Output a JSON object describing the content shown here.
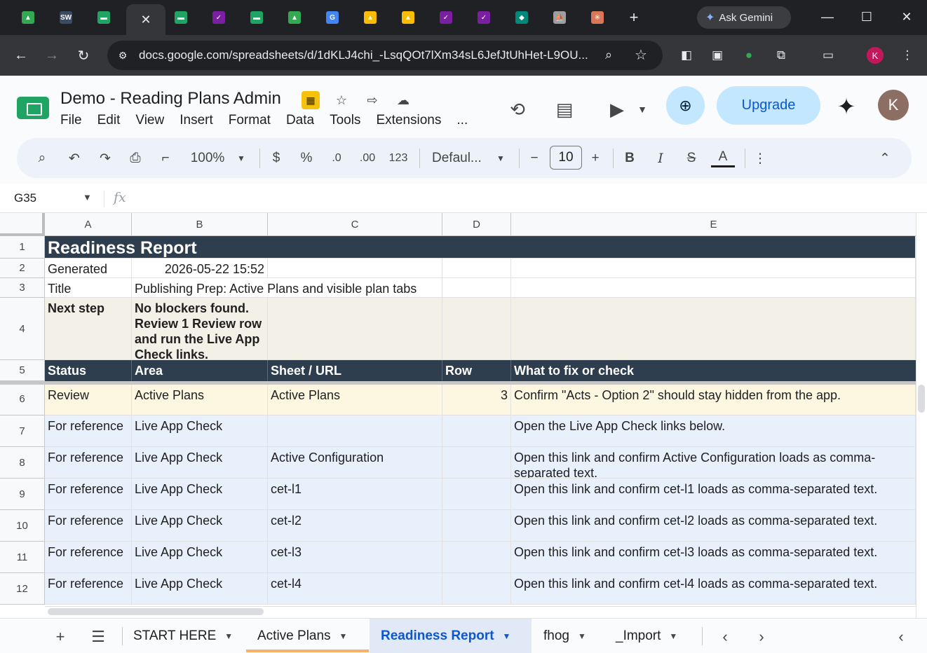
{
  "browser": {
    "active_tab_close": "✕",
    "new_tab": "+",
    "ask_gemini": "Ask Gemini",
    "url": "docs.google.com/spreadsheets/d/1dKLJ4chi_-LsqQOt7lXm34sL6JefJtUhHet-L9OU...",
    "profile_initial": "K",
    "favicons": [
      {
        "name": "gdrive-favicon",
        "color": "#34a853",
        "glyph": "▲"
      },
      {
        "name": "sw-favicon",
        "color": "#3c4b64",
        "glyph": "SW"
      },
      {
        "name": "sheets-favicon",
        "color": "#1fa463",
        "glyph": "▬"
      },
      {
        "name": "sheets-favicon",
        "color": "#1fa463",
        "glyph": "▬"
      },
      {
        "name": "chart-favicon",
        "color": "#7b1fa2",
        "glyph": "✓"
      },
      {
        "name": "sheets-favicon",
        "color": "#1fa463",
        "glyph": "▬"
      },
      {
        "name": "gdrive-favicon",
        "color": "#34a853",
        "glyph": "▲"
      },
      {
        "name": "google-favicon",
        "color": "#4285f4",
        "glyph": "G"
      },
      {
        "name": "drive-favicon",
        "color": "#fbbc04",
        "glyph": "▲"
      },
      {
        "name": "drive-favicon",
        "color": "#fbbc04",
        "glyph": "▲"
      },
      {
        "name": "chart-favicon",
        "color": "#7b1fa2",
        "glyph": "✓"
      },
      {
        "name": "chart-favicon",
        "color": "#7b1fa2",
        "glyph": "✓"
      },
      {
        "name": "diamond-favicon",
        "color": "#00897b",
        "glyph": "◆"
      },
      {
        "name": "boat-favicon",
        "color": "#9e9e9e",
        "glyph": "⛵"
      },
      {
        "name": "claude-favicon",
        "color": "#d97757",
        "glyph": "✳"
      }
    ]
  },
  "doc": {
    "title": "Demo - Reading Plans Admin",
    "menus": [
      "File",
      "Edit",
      "View",
      "Insert",
      "Format",
      "Data",
      "Tools",
      "Extensions",
      "..."
    ],
    "upgrade_label": "Upgrade",
    "account_initial": "K"
  },
  "toolbar": {
    "zoom": "100%",
    "currency": "$",
    "percent": "%",
    "dec_decrease": ".0",
    "dec_increase": ".00",
    "number_format": "123",
    "font": "Defaul...",
    "font_size": "10",
    "bold": "B",
    "italic": "I",
    "strike": "S",
    "text_color": "A"
  },
  "formula_bar": {
    "cell_ref": "G35",
    "fx": "fx",
    "content": ""
  },
  "grid": {
    "columns": [
      "A",
      "B",
      "C",
      "D",
      "E"
    ],
    "row_numbers": [
      "1",
      "2",
      "3",
      "4",
      "5",
      "6",
      "7",
      "8",
      "9",
      "10",
      "11",
      "12"
    ],
    "title": "Readiness Report",
    "generated_label": "Generated",
    "generated_value": "2026-05-22 15:52",
    "title_label": "Title",
    "title_value": "Publishing Prep: Active Plans and visible plan tabs",
    "next_step_label": "Next step",
    "next_step_value": "No blockers found. Review 1 Review row and run the Live App Check links.",
    "headers": [
      "Status",
      "Area",
      "Sheet / URL",
      "Row",
      "What to fix or check"
    ],
    "rows": [
      {
        "status": "Review",
        "area": "Active Plans",
        "sheet": "Active Plans",
        "row": "3",
        "check": "Confirm \"Acts - Option 2\" should stay hidden from the app."
      },
      {
        "status": "For reference",
        "area": "Live App Check",
        "sheet": "",
        "row": "",
        "check": "Open the Live App Check links below."
      },
      {
        "status": "For reference",
        "area": "Live App Check",
        "sheet": "Active Configuration",
        "row": "",
        "check": "Open this link and confirm Active Configuration loads as comma-separated text."
      },
      {
        "status": "For reference",
        "area": "Live App Check",
        "sheet": "cet-l1",
        "row": "",
        "check": "Open this link and confirm cet-l1 loads as comma-separated text."
      },
      {
        "status": "For reference",
        "area": "Live App Check",
        "sheet": "cet-l2",
        "row": "",
        "check": "Open this link and confirm cet-l2 loads as comma-separated text."
      },
      {
        "status": "For reference",
        "area": "Live App Check",
        "sheet": "cet-l3",
        "row": "",
        "check": "Open this link and confirm cet-l3 loads as comma-separated text."
      },
      {
        "status": "For reference",
        "area": "Live App Check",
        "sheet": "cet-l4",
        "row": "",
        "check": "Open this link and confirm cet-l4 loads as comma-separated text."
      }
    ]
  },
  "sheet_tabs": {
    "tabs": [
      "START HERE",
      "Active Plans",
      "Readiness Report",
      "fhog",
      "_Import"
    ],
    "active": "Readiness Report"
  },
  "colors": {
    "header_fill": "#2f3e4e",
    "note_fill": "#f3f0e8",
    "review_fill": "#fdf7e1",
    "reference_fill": "#e8f0fb",
    "accent": "#0b57d0"
  }
}
